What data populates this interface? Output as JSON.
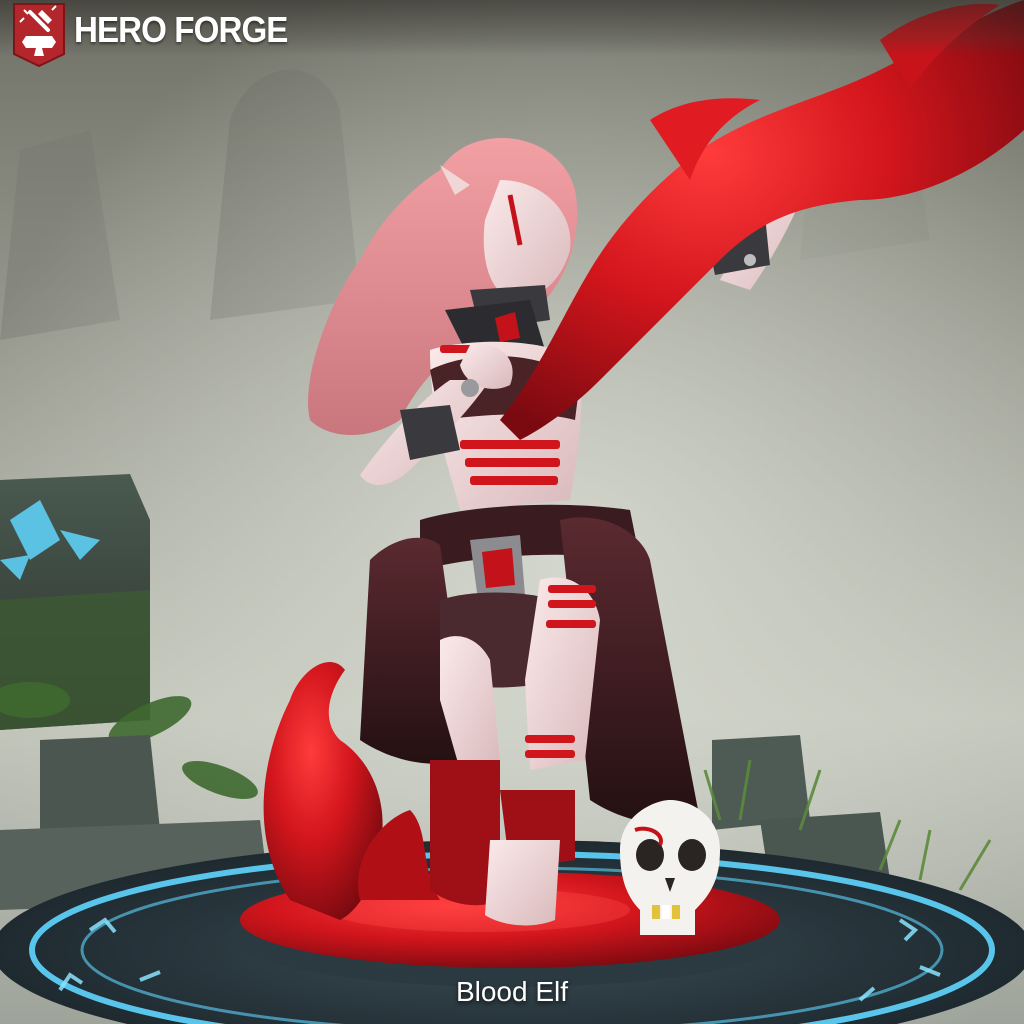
{
  "brand": {
    "name": "HERO FORGE",
    "logo_icon": "anvil-hammer-icon",
    "badge_color": "#b3262b"
  },
  "miniature": {
    "name": "Blood Elf"
  },
  "colors": {
    "blood": "#d1151c",
    "skin": "#f0dada",
    "hair": "#e78d93",
    "cloth": "#3e1d21",
    "rune_glow": "#5fd6ff",
    "fog": "#b9bcb1"
  }
}
